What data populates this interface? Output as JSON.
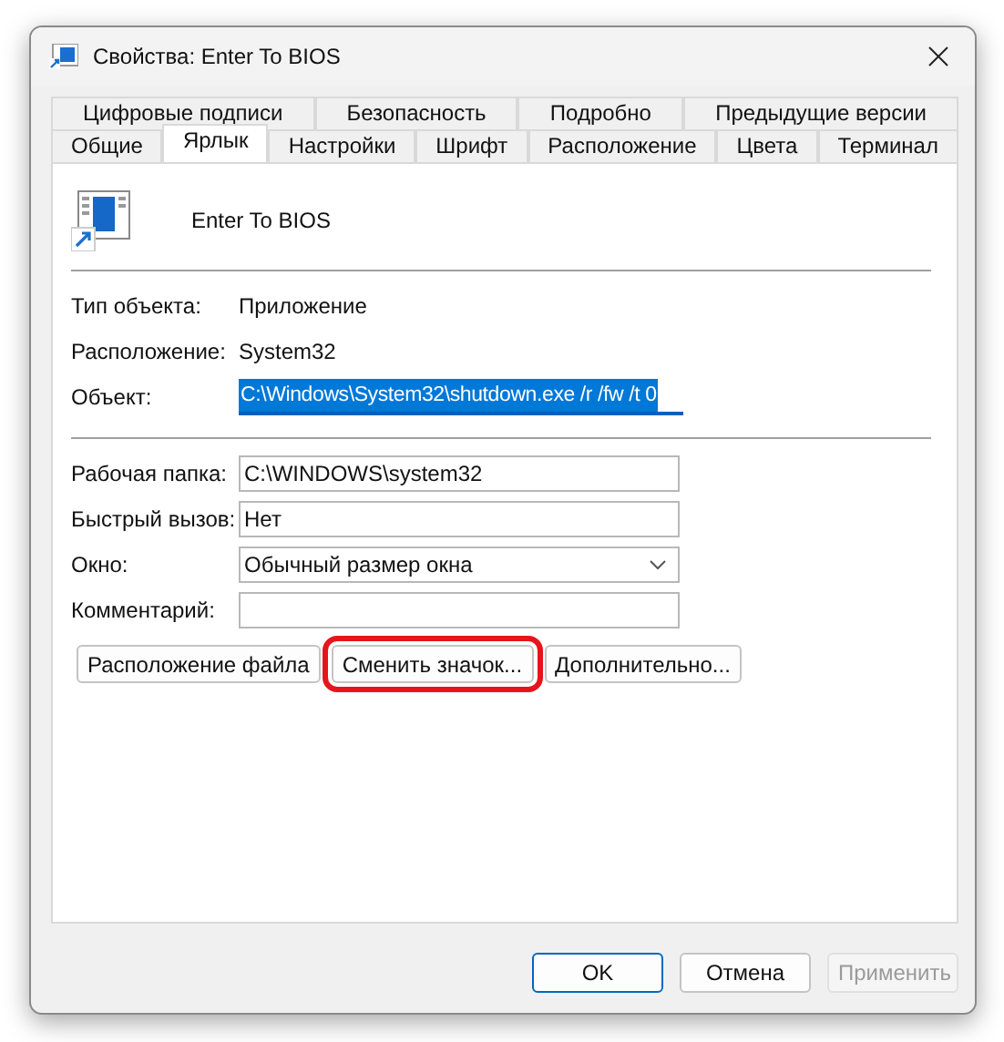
{
  "window": {
    "title": "Свойства: Enter To BIOS"
  },
  "tab_rows": [
    [
      {
        "label": "Цифровые подписи",
        "selected": false
      },
      {
        "label": "Безопасность",
        "selected": false
      },
      {
        "label": "Подробно",
        "selected": false
      },
      {
        "label": "Предыдущие версии",
        "selected": false
      }
    ],
    [
      {
        "label": "Общие",
        "selected": false
      },
      {
        "label": "Ярлык",
        "selected": true
      },
      {
        "label": "Настройки",
        "selected": false
      },
      {
        "label": "Шрифт",
        "selected": false
      },
      {
        "label": "Расположение",
        "selected": false
      },
      {
        "label": "Цвета",
        "selected": false
      },
      {
        "label": "Терминал",
        "selected": false
      }
    ]
  ],
  "shortcut": {
    "name": "Enter To BIOS"
  },
  "info": [
    {
      "label": "Тип объекта:",
      "value": "Приложение"
    },
    {
      "label": "Расположение:",
      "value": "System32"
    }
  ],
  "target": {
    "label": "Объект:",
    "value": "C:\\Windows\\System32\\shutdown.exe /r /fw /t 0",
    "text_selected": true
  },
  "fields": [
    {
      "kind": "text",
      "label": "Рабочая папка:",
      "value": "C:\\WINDOWS\\system32"
    },
    {
      "kind": "text",
      "label": "Быстрый вызов:",
      "value": "Нет"
    },
    {
      "kind": "dropdown",
      "label": "Окно:",
      "value": "Обычный размер окна"
    },
    {
      "kind": "text",
      "label": "Комментарий:"
    }
  ],
  "actions": [
    {
      "label": "Расположение файла",
      "highlighted": false
    },
    {
      "label": "Сменить значок...",
      "highlighted": true
    },
    {
      "label": "Дополнительно...",
      "highlighted": false
    }
  ],
  "dialog_buttons": [
    {
      "label": "OK",
      "default": true,
      "disabled": false
    },
    {
      "label": "Отмена",
      "default": false,
      "disabled": false
    },
    {
      "label": "Применить",
      "default": false,
      "disabled": true
    }
  ]
}
